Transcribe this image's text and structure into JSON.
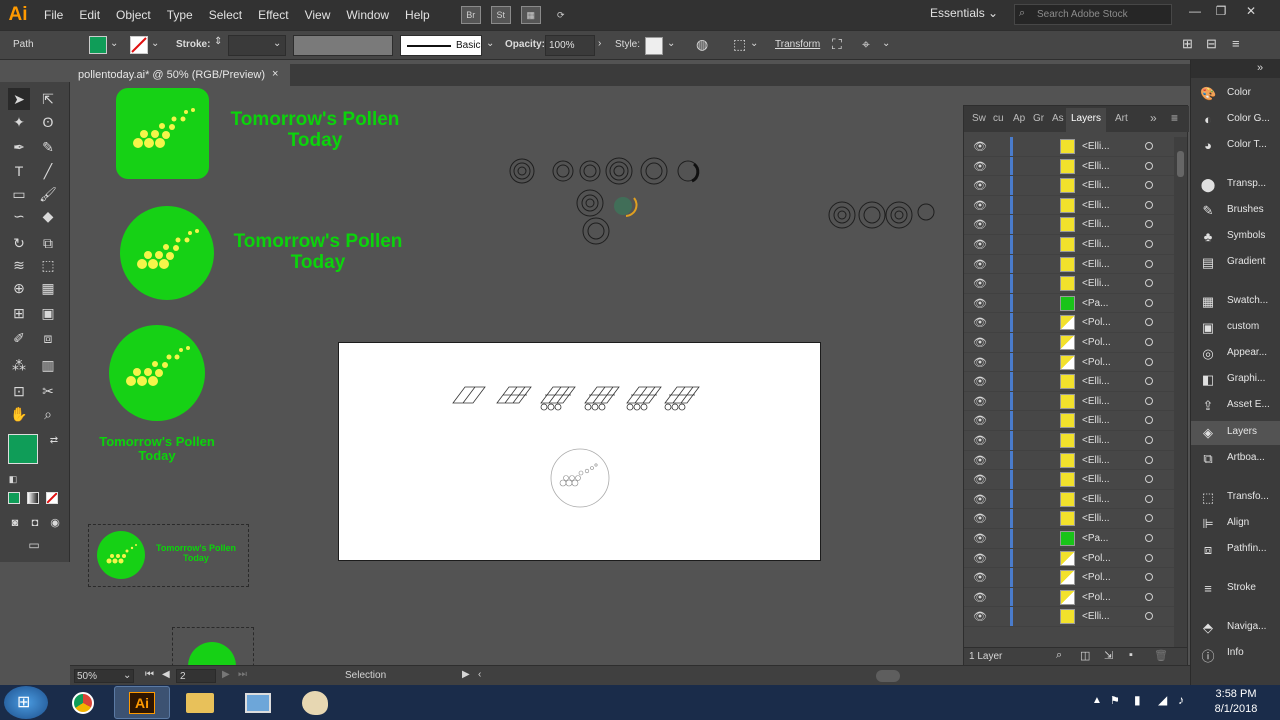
{
  "menubar": {
    "logo": "Ai",
    "items": [
      "File",
      "Edit",
      "Object",
      "Type",
      "Select",
      "Effect",
      "View",
      "Window",
      "Help"
    ],
    "app_icons": [
      "Br",
      "St"
    ],
    "workspace": "Essentials",
    "search_placeholder": "Search Adobe Stock"
  },
  "control": {
    "selection_type": "Path",
    "stroke_label": "Stroke:",
    "brush": "Basic",
    "opacity_label": "Opacity:",
    "opacity_value": "100%",
    "style_label": "Style:",
    "transform_label": "Transform",
    "fill_color": "#0f9d58",
    "accent_color": "#16d115"
  },
  "document": {
    "tab_title": "pollentoday.ai* @ 50% (RGB/Preview)",
    "close": "×"
  },
  "canvas": {
    "logo_text_line1": "Tomorrow's Pollen",
    "logo_text_line2": "Today"
  },
  "status": {
    "zoom": "50%",
    "artboard_num": "2",
    "tool": "Selection"
  },
  "layers_panel": {
    "tabs": [
      "Sw",
      "cu",
      "Ap",
      "Gr",
      "As",
      "Layers",
      "Art"
    ],
    "active_tab": "Layers",
    "footer": "1 Layer",
    "rows": [
      {
        "name": "<Elli...",
        "thumb": "yellow"
      },
      {
        "name": "<Elli...",
        "thumb": "yellow"
      },
      {
        "name": "<Elli...",
        "thumb": "yellow"
      },
      {
        "name": "<Elli...",
        "thumb": "yellow"
      },
      {
        "name": "<Elli...",
        "thumb": "yellow"
      },
      {
        "name": "<Elli...",
        "thumb": "yellow"
      },
      {
        "name": "<Elli...",
        "thumb": "yellow"
      },
      {
        "name": "<Elli...",
        "thumb": "yellow"
      },
      {
        "name": "<Pa...",
        "thumb": "green"
      },
      {
        "name": "<Pol...",
        "thumb": "mixed"
      },
      {
        "name": "<Pol...",
        "thumb": "mixed"
      },
      {
        "name": "<Pol...",
        "thumb": "mixed"
      },
      {
        "name": "<Elli...",
        "thumb": "yellow"
      },
      {
        "name": "<Elli...",
        "thumb": "yellow"
      },
      {
        "name": "<Elli...",
        "thumb": "yellow"
      },
      {
        "name": "<Elli...",
        "thumb": "yellow"
      },
      {
        "name": "<Elli...",
        "thumb": "yellow"
      },
      {
        "name": "<Elli...",
        "thumb": "yellow"
      },
      {
        "name": "<Elli...",
        "thumb": "yellow"
      },
      {
        "name": "<Elli...",
        "thumb": "yellow"
      },
      {
        "name": "<Pa...",
        "thumb": "green"
      },
      {
        "name": "<Pol...",
        "thumb": "mixed"
      },
      {
        "name": "<Pol...",
        "thumb": "mixed"
      },
      {
        "name": "<Pol...",
        "thumb": "mixed"
      },
      {
        "name": "<Elli...",
        "thumb": "yellow"
      }
    ]
  },
  "dock": {
    "items": [
      "Color",
      "Color G...",
      "Color T...",
      "Transp...",
      "Brushes",
      "Symbols",
      "Gradient",
      "Swatch...",
      "custom",
      "Appear...",
      "Graphi...",
      "Asset E...",
      "Layers",
      "Artboa...",
      "Transfo...",
      "Align",
      "Pathfin...",
      "Stroke",
      "Naviga...",
      "Info"
    ],
    "active": "Layers"
  },
  "taskbar": {
    "time": "3:58 PM",
    "date": "8/1/2018",
    "ai_label": "Ai"
  }
}
